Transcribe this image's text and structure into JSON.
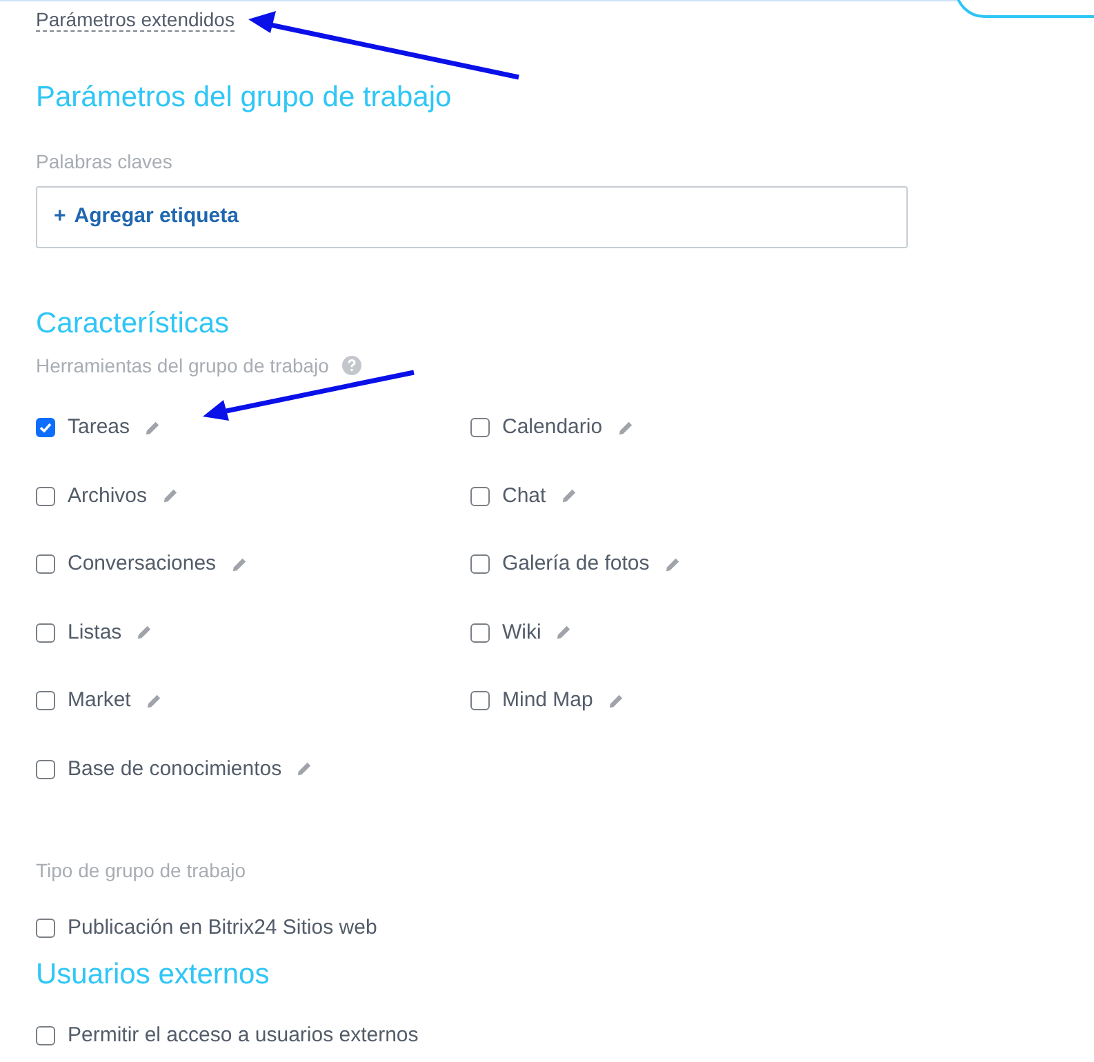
{
  "extended_link": "Parámetros extendidos",
  "group_section": {
    "title": "Parámetros del grupo de trabajo",
    "keywords_label": "Palabras claves",
    "add_tag": {
      "icon": "+",
      "label": "Agregar etiqueta"
    }
  },
  "features": {
    "title": "Características",
    "tools_label": "Herramientas del grupo de trabajo",
    "tools": [
      {
        "label": "Tareas",
        "checked": true
      },
      {
        "label": "Calendario",
        "checked": false
      },
      {
        "label": "Archivos",
        "checked": false
      },
      {
        "label": "Chat",
        "checked": false
      },
      {
        "label": "Conversaciones",
        "checked": false
      },
      {
        "label": "Galería de fotos",
        "checked": false
      },
      {
        "label": "Listas",
        "checked": false
      },
      {
        "label": "Wiki",
        "checked": false
      },
      {
        "label": "Market",
        "checked": false
      },
      {
        "label": "Mind Map",
        "checked": false
      },
      {
        "label": "Base de conocimientos",
        "checked": false
      }
    ]
  },
  "group_type": {
    "label": "Tipo de grupo de trabajo",
    "option": {
      "label": "Publicación en Bitrix24 Sitios web",
      "checked": false
    }
  },
  "external_users": {
    "title": "Usuarios externos",
    "option": {
      "label": "Permitir el acceso a usuarios externos",
      "checked": false
    }
  }
}
